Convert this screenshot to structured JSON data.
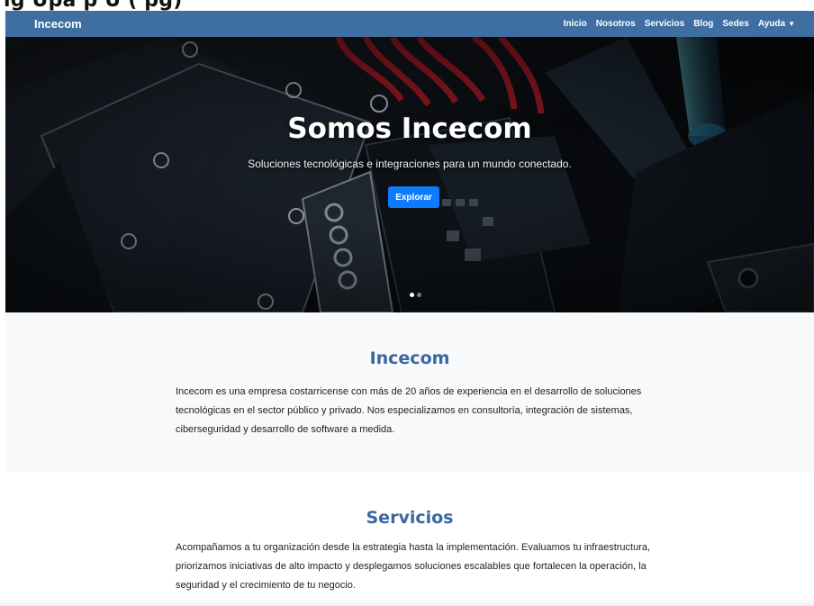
{
  "header_fragment": "ig Upa  p  U  (  pg)",
  "navbar": {
    "brand": "Incecom",
    "links": [
      "Inicio",
      "Nosotros",
      "Servicios",
      "Blog",
      "Sedes",
      "Ayuda"
    ],
    "color": "#3f6fa2"
  },
  "hero": {
    "title": "Somos Incecom",
    "subtitle": "Soluciones tecnológicas e integraciones para un mundo conectado.",
    "button_label": "Explorar",
    "button_color": "#0d7bff",
    "active_slide": 1,
    "slide_count": 2
  },
  "about": {
    "title": "Incecom",
    "text": "Incecom es una empresa costarricense con más de 20 años de experiencia en el desarrollo de soluciones tecnológicas en el sector público y privado. Nos especializamos en consultoría, integración de sistemas, ciberseguridad y desarrollo de software a medida."
  },
  "services": {
    "title": "Servicios",
    "text": "Acompañamos a tu organización desde la estrategia hasta la implementación. Evaluamos tu infraestructura, priorizamos iniciativas de alto impacto y desplegamos soluciones escalables que fortalecen la operación, la seguridad y el crecimiento de tu negocio."
  },
  "accent_title_color": "#3a67a0"
}
